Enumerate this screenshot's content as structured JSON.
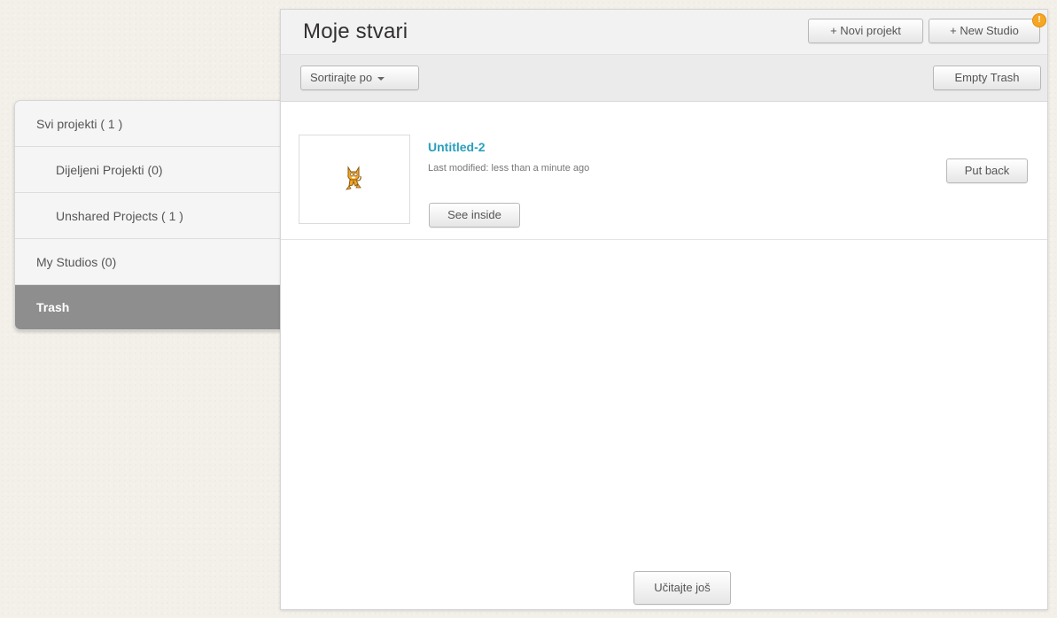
{
  "sidebar": {
    "items": [
      {
        "label": "Svi projekti ( 1 )"
      },
      {
        "label": "Dijeljeni Projekti (0)"
      },
      {
        "label": "Unshared Projects ( 1 )"
      },
      {
        "label": "My Studios (0)"
      },
      {
        "label": "Trash"
      }
    ]
  },
  "header": {
    "title": "Moje stvari",
    "new_project_label": "+ Novi projekt",
    "new_studio_label": "+ New Studio",
    "alert_badge": "!"
  },
  "toolbar": {
    "sort_label": "Sortirajte po",
    "empty_trash_label": "Empty Trash"
  },
  "projects": [
    {
      "title": "Untitled-2",
      "modified": "Last modified: less than a minute ago",
      "see_inside_label": "See inside",
      "put_back_label": "Put back",
      "thumbnail_icon": "scratch-cat-icon"
    }
  ],
  "footer": {
    "load_more_label": "Učitajte još"
  },
  "colors": {
    "accent_link": "#2a9fbc",
    "active_sidebar": "#8e8e8e",
    "alert_badge": "#f5a623"
  }
}
